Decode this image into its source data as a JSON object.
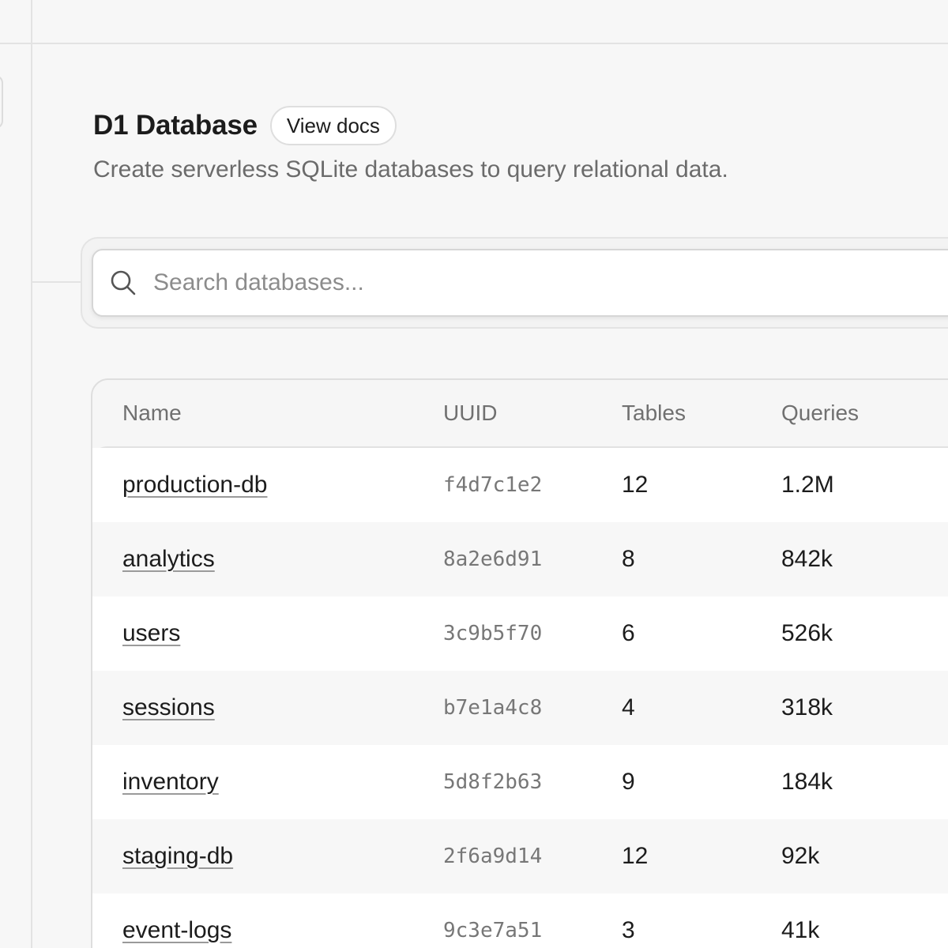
{
  "header": {
    "title": "D1 Database",
    "docs_label": "View docs",
    "subtitle": "Create serverless SQLite databases to query relational data."
  },
  "search": {
    "placeholder": "Search databases...",
    "value": "",
    "icon": "search-icon"
  },
  "table": {
    "columns": [
      "Name",
      "UUID",
      "Tables",
      "Queries"
    ],
    "rows": [
      {
        "name": "production-db",
        "uuid": "f4d7c1e2",
        "tables": "12",
        "queries": "1.2M"
      },
      {
        "name": "analytics",
        "uuid": "8a2e6d91",
        "tables": "8",
        "queries": "842k"
      },
      {
        "name": "users",
        "uuid": "3c9b5f70",
        "tables": "6",
        "queries": "526k"
      },
      {
        "name": "sessions",
        "uuid": "b7e1a4c8",
        "tables": "4",
        "queries": "318k"
      },
      {
        "name": "inventory",
        "uuid": "5d8f2b63",
        "tables": "9",
        "queries": "184k"
      },
      {
        "name": "staging-db",
        "uuid": "2f6a9d14",
        "tables": "12",
        "queries": "92k"
      },
      {
        "name": "event-logs",
        "uuid": "9c3e7a51",
        "tables": "3",
        "queries": "41k"
      }
    ]
  },
  "colors": {
    "background": "#f7f7f7",
    "text": "#1c1c1c",
    "muted": "#6b6b6b",
    "border": "#dedede"
  }
}
